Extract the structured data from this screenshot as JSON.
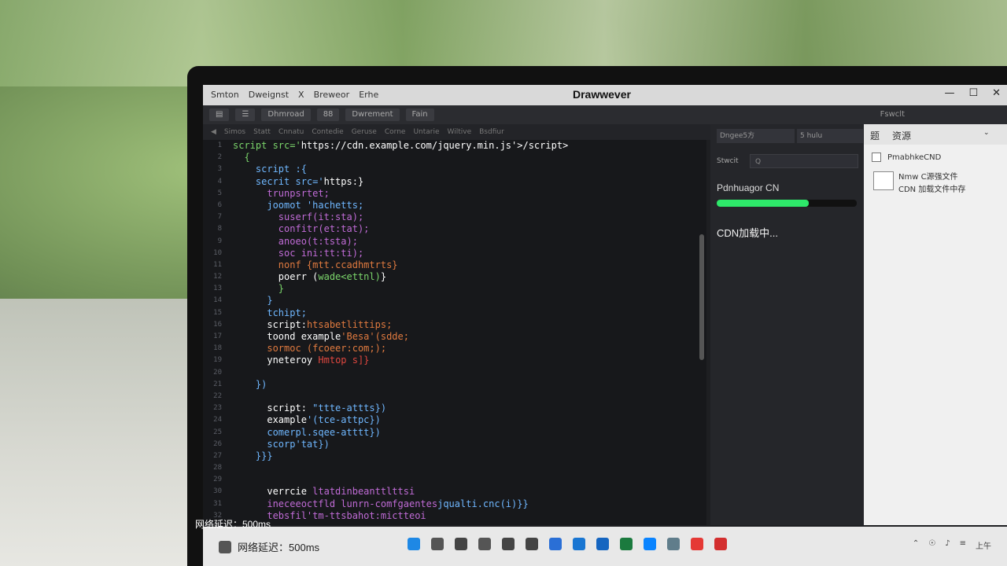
{
  "window": {
    "title": "Drawwever",
    "menu": [
      "Smton",
      "Dweignst",
      "X",
      "Breweor",
      "Erhe"
    ],
    "controls": [
      "—",
      "☐",
      "✕"
    ]
  },
  "toolbar": {
    "btn1": "Dhmroad",
    "btn2": "88",
    "btn3": "Dwrement",
    "btn4": "Fain",
    "publish": "Fswclt"
  },
  "tabs": [
    "Simos",
    "Statt",
    "Cnnatu",
    "Contedie",
    "Geruse",
    "Corne",
    "Untarie",
    "Wiltive",
    "Bsdfiur"
  ],
  "editor": {
    "line_numbers": [
      "1",
      "2",
      "3",
      "4",
      "5",
      "6",
      "7",
      "8",
      "9",
      "10",
      "11",
      "12",
      "13",
      "14",
      "15",
      "16",
      "17",
      "18",
      "19",
      "20",
      "21",
      "22",
      "23",
      "24",
      "25",
      "26",
      "27",
      "28",
      "29",
      "30",
      "31",
      "32"
    ],
    "lines": [
      {
        "indent": "",
        "parts": [
          {
            "t": "script src='",
            "c": "#7bd66b"
          },
          {
            "t": "https://cdn.example.com/jquery.min.js",
            "c": "#ffffff"
          },
          {
            "t": "'>/script>",
            "c": "#ffffff"
          }
        ]
      },
      {
        "indent": "  ",
        "parts": [
          {
            "t": "{",
            "c": "#7bd66b"
          }
        ]
      },
      {
        "indent": "    ",
        "parts": [
          {
            "t": "script :{",
            "c": "#6fb7ff"
          }
        ]
      },
      {
        "indent": "    ",
        "parts": [
          {
            "t": "secrit src='",
            "c": "#6fb7ff"
          },
          {
            "t": "https:}",
            "c": "#ffffff"
          }
        ]
      },
      {
        "indent": "      ",
        "parts": [
          {
            "t": "trunpsrtet;",
            "c": "#c06bd6"
          }
        ]
      },
      {
        "indent": "      ",
        "parts": [
          {
            "t": "joomot 'hachetts;",
            "c": "#6fb7ff"
          }
        ]
      },
      {
        "indent": "        ",
        "parts": [
          {
            "t": "suserf(it:sta);",
            "c": "#c06bd6"
          }
        ]
      },
      {
        "indent": "        ",
        "parts": [
          {
            "t": "confitr(et:tat);",
            "c": "#c06bd6"
          }
        ]
      },
      {
        "indent": "        ",
        "parts": [
          {
            "t": "anoeo(t:tsta);",
            "c": "#c06bd6"
          }
        ]
      },
      {
        "indent": "        ",
        "parts": [
          {
            "t": "soc ini:tt:ti);",
            "c": "#c06bd6"
          }
        ]
      },
      {
        "indent": "        ",
        "parts": [
          {
            "t": "nonf {mtt.ccadhmtrts}",
            "c": "#e07a3f"
          }
        ]
      },
      {
        "indent": "        ",
        "parts": [
          {
            "t": "poerr (",
            "c": "#ffffff"
          },
          {
            "t": "wade<ettnl)",
            "c": "#7bd66b"
          },
          {
            "t": "}",
            "c": "#ffffff"
          }
        ]
      },
      {
        "indent": "        ",
        "parts": [
          {
            "t": "}",
            "c": "#7bd66b"
          }
        ]
      },
      {
        "indent": "      ",
        "parts": [
          {
            "t": "}",
            "c": "#6fb7ff"
          }
        ]
      },
      {
        "indent": "      ",
        "parts": [
          {
            "t": "tchipt;",
            "c": "#6fb7ff"
          }
        ]
      },
      {
        "indent": "      ",
        "parts": [
          {
            "t": "script:",
            "c": "#ffffff"
          },
          {
            "t": "htsabetlittips;",
            "c": "#e07a3f"
          }
        ]
      },
      {
        "indent": "      ",
        "parts": [
          {
            "t": "toond example",
            "c": "#ffffff"
          },
          {
            "t": "'Besa'(sdde;",
            "c": "#e07a3f"
          }
        ]
      },
      {
        "indent": "      ",
        "parts": [
          {
            "t": "sormoc (fcoeer:com;);",
            "c": "#e07a3f"
          }
        ]
      },
      {
        "indent": "      ",
        "parts": [
          {
            "t": "yneteroy ",
            "c": "#ffffff"
          },
          {
            "t": "Hmtop s]}",
            "c": "#e0473f"
          }
        ]
      },
      {
        "indent": "",
        "parts": [
          {
            "t": "",
            "c": "#ffffff"
          }
        ]
      },
      {
        "indent": "    ",
        "parts": [
          {
            "t": "})",
            "c": "#6fb7ff"
          }
        ]
      },
      {
        "indent": "",
        "parts": [
          {
            "t": "",
            "c": "#ffffff"
          }
        ]
      },
      {
        "indent": "      ",
        "parts": [
          {
            "t": "script: ",
            "c": "#ffffff"
          },
          {
            "t": "\"ttte-attts})",
            "c": "#6fb7ff"
          }
        ]
      },
      {
        "indent": "      ",
        "parts": [
          {
            "t": "example",
            "c": "#ffffff"
          },
          {
            "t": "'(tce-attpc})",
            "c": "#6fb7ff"
          }
        ]
      },
      {
        "indent": "      ",
        "parts": [
          {
            "t": "comerpl.sqee-atttt})",
            "c": "#6fb7ff"
          }
        ]
      },
      {
        "indent": "      ",
        "parts": [
          {
            "t": "scorp'tat})",
            "c": "#6fb7ff"
          }
        ]
      },
      {
        "indent": "    ",
        "parts": [
          {
            "t": "}}}",
            "c": "#6fb7ff"
          }
        ]
      },
      {
        "indent": "",
        "parts": [
          {
            "t": "",
            "c": "#ffffff"
          }
        ]
      },
      {
        "indent": "",
        "parts": [
          {
            "t": "",
            "c": "#ffffff"
          }
        ]
      },
      {
        "indent": "      ",
        "parts": [
          {
            "t": "verrcie ",
            "c": "#ffffff"
          },
          {
            "t": "ltatdinbeanttlttsi",
            "c": "#c06bd6"
          }
        ]
      },
      {
        "indent": "      ",
        "parts": [
          {
            "t": "ineceeoctfld lunrn-comfgaentes",
            "c": "#c06bd6"
          },
          {
            "t": "jqualti.cnc(i)}}",
            "c": "#6fb7ff"
          }
        ]
      },
      {
        "indent": "      ",
        "parts": [
          {
            "t": "tebsfil'tm-ttsbahot:mictteoi",
            "c": "#c06bd6"
          }
        ]
      }
    ]
  },
  "panel": {
    "dropdown1": "Dngee5方",
    "dropdown2": "5 hulu",
    "search_label": "Stwcit",
    "search_placeholder": "Q",
    "progress_label": "Pdnhuagor CN",
    "progress_value": 0.66,
    "loading_text": "CDN加载中..."
  },
  "assets": {
    "title": "资源",
    "tab": "题",
    "item1": "PmabhkeCND",
    "item2": "Nmw C源强文件",
    "item3": "CDN 加载文件中存"
  },
  "status": {
    "overlay_text": "网络延迟：500ms",
    "taskbar_text": "网络延迟：500ms"
  },
  "taskbar": {
    "icons": [
      {
        "name": "windows-start-icon",
        "color": "#1e88e5"
      },
      {
        "name": "taskview-icon",
        "color": "#555555"
      },
      {
        "name": "gallery-icon",
        "color": "#444444"
      },
      {
        "name": "files-icon",
        "color": "#555555"
      },
      {
        "name": "home-icon",
        "color": "#444444"
      },
      {
        "name": "search-icon",
        "color": "#444444"
      },
      {
        "name": "store-icon",
        "color": "#2a6fd6"
      },
      {
        "name": "chat-icon",
        "color": "#1976d2"
      },
      {
        "name": "code-icon",
        "color": "#1565c0"
      },
      {
        "name": "excel-icon",
        "color": "#1b7a3e"
      },
      {
        "name": "edge-icon",
        "color": "#0a84ff"
      },
      {
        "name": "settings-icon",
        "color": "#607d8b"
      },
      {
        "name": "photos-icon",
        "color": "#e53935"
      },
      {
        "name": "pdf-icon",
        "color": "#d32f2f"
      }
    ],
    "tray": [
      "⌃",
      "☉",
      "♪",
      "≡"
    ],
    "clock": "上午"
  }
}
